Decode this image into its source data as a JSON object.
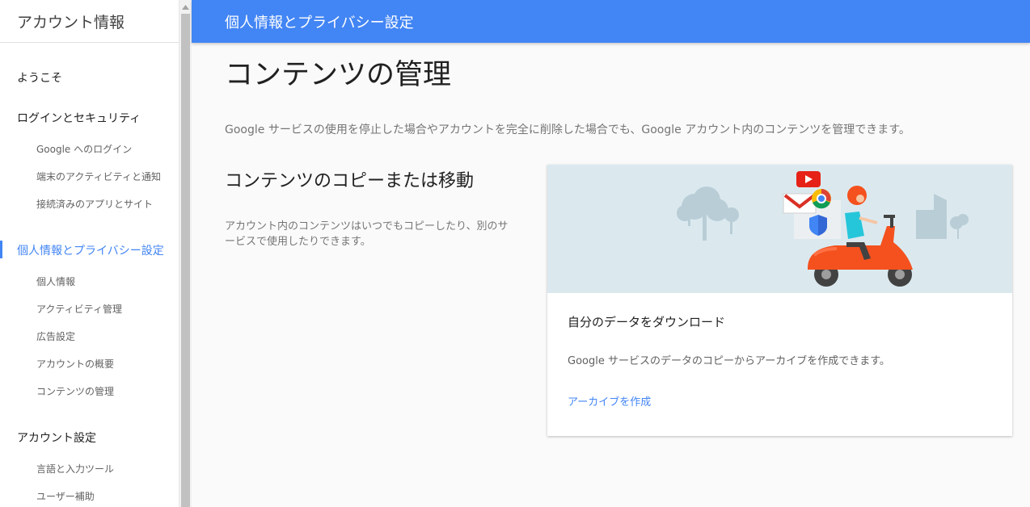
{
  "sidebar": {
    "title": "アカウント情報",
    "items": [
      {
        "label": "ようこそ"
      },
      {
        "label": "ログインとセキュリティ"
      },
      {
        "label": "Google へのログイン"
      },
      {
        "label": "端末のアクティビティと通知"
      },
      {
        "label": "接続済みのアプリとサイト"
      },
      {
        "label": "個人情報とプライバシー設定"
      },
      {
        "label": "個人情報"
      },
      {
        "label": "アクティビティ管理"
      },
      {
        "label": "広告設定"
      },
      {
        "label": "アカウントの概要"
      },
      {
        "label": "コンテンツの管理"
      },
      {
        "label": "アカウント設定"
      },
      {
        "label": "言語と入力ツール"
      },
      {
        "label": "ユーザー補助"
      }
    ]
  },
  "header": {
    "title": "個人情報とプライバシー設定"
  },
  "main": {
    "title": "コンテンツの管理",
    "description": "Google サービスの使用を停止した場合やアカウントを完全に削除した場合でも、Google アカウント内のコンテンツを管理できます。",
    "section": {
      "title": "コンテンツのコピーまたは移動",
      "description": "アカウント内のコンテンツはいつでもコピーしたり、別のサービスで使用したりできます。"
    }
  },
  "card": {
    "title": "自分のデータをダウンロード",
    "text": "Google サービスのデータのコピーからアーカイブを作成できます。",
    "link": "アーカイブを作成"
  },
  "colors": {
    "accent": "#4285f4",
    "illustration_bg": "#dbe9ef",
    "scooter": "#f4511e"
  },
  "icons": [
    "youtube-icon",
    "gmail-icon",
    "chrome-icon",
    "shield-icon",
    "scooter-icon",
    "tree-icon",
    "building-icon"
  ]
}
